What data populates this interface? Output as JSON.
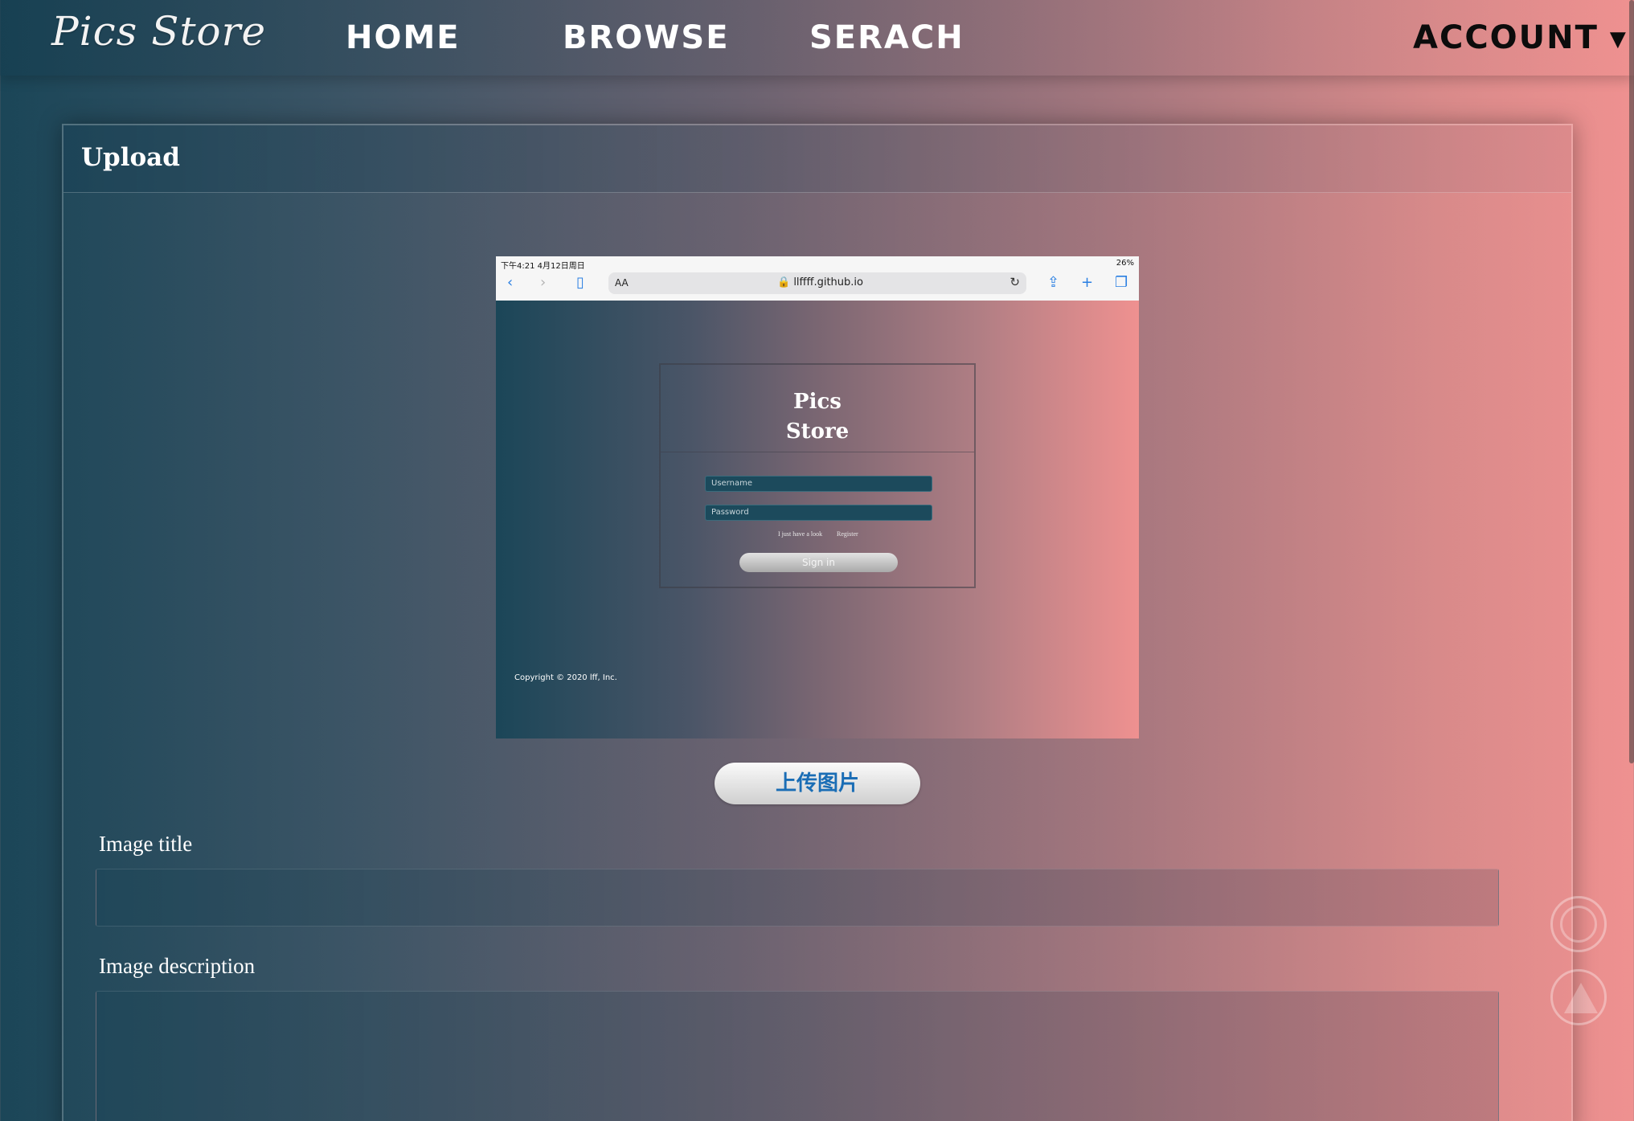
{
  "nav": {
    "logo": "Pics Store",
    "home": "HOME",
    "browse": "BROWSE",
    "search": "SERACH",
    "account": "ACCOUNT",
    "account_caret": "▼"
  },
  "panel": {
    "title": "Upload"
  },
  "preview": {
    "status_time": "下午4:21  4月12日周日",
    "status_battery": "26%",
    "url_aa": "AA",
    "url": "🔒 llffff.github.io",
    "login_title_line1": "Pics",
    "login_title_line2": "Store",
    "username_placeholder": "Username",
    "password_placeholder": "Password",
    "link_look": "I just have a look",
    "link_register": "Register",
    "signin": "Sign in",
    "copyright": "Copyright © 2020 lff, Inc."
  },
  "upload": {
    "button_label": "上传图片"
  },
  "form": {
    "title_label": "Image title",
    "title_value": "",
    "description_label": "Image description",
    "description_value": ""
  }
}
